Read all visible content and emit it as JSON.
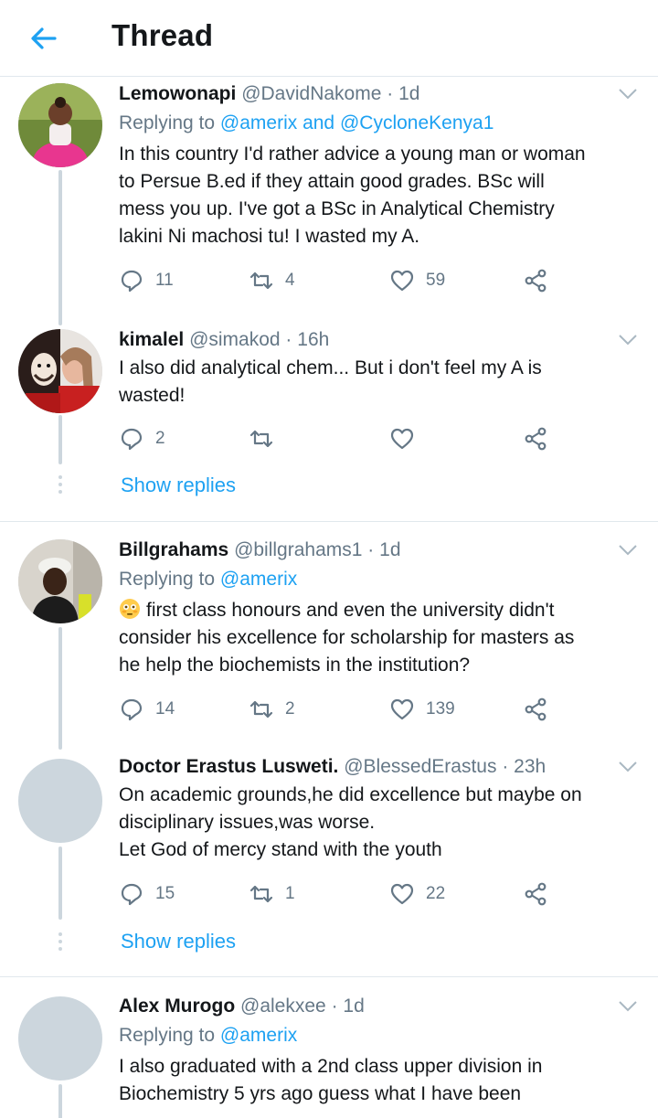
{
  "header": {
    "title": "Thread"
  },
  "colors": {
    "accent": "#1da1f2",
    "muted": "#657786",
    "text": "#14171a",
    "line": "#ccd6dd",
    "border": "#e1e8ed"
  },
  "tweets": [
    {
      "name": "Lemowonapi",
      "handle": "@DavidNakome",
      "sep": "·",
      "time": "1d",
      "replying_prefix": "Replying to",
      "mention1": "@amerix",
      "joiner": "and",
      "mention2": "@CycloneKenya1",
      "lines": [
        "In this country I'd rather advice a young man or woman",
        "to Persue B.ed if they attain good grades. BSc will",
        "mess you up. I've got a BSc in Analytical Chemistry",
        "lakini Ni machosi tu! I wasted my A."
      ],
      "replies": "11",
      "retweets": "4",
      "likes": "59"
    },
    {
      "name": "kimalel",
      "handle": "@simakod",
      "sep": "·",
      "time": "16h",
      "lines": [
        "I also did analytical chem... But i don't feel my A is",
        "wasted!"
      ],
      "replies": "2",
      "retweets": "",
      "likes": "",
      "show_replies": "Show replies"
    },
    {
      "name": "Billgrahams",
      "handle": "@billgrahams1",
      "sep": "·",
      "time": "1d",
      "replying_prefix": "Replying to",
      "mention1": "@amerix",
      "lines": [
        "first class honours and even the university didn't",
        "consider his excellence for scholarship for masters as",
        "he help the biochemists in the institution?"
      ],
      "replies": "14",
      "retweets": "2",
      "likes": "139"
    },
    {
      "name": "Doctor Erastus Lusweti.",
      "handle": "@BlessedErastus",
      "sep": "·",
      "time": "23h",
      "lines": [
        "On academic grounds,he did excellence but maybe on",
        "disciplinary issues,was worse.",
        "Let God of mercy stand with the youth"
      ],
      "replies": "15",
      "retweets": "1",
      "likes": "22",
      "show_replies": "Show replies"
    },
    {
      "name": "Alex Murogo",
      "handle": "@alekxee",
      "sep": "·",
      "time": "1d",
      "replying_prefix": "Replying to",
      "mention1": "@amerix",
      "lines": [
        "I also graduated with a 2nd class upper division in",
        "Biochemistry 5 yrs ago guess what I have been"
      ]
    }
  ]
}
